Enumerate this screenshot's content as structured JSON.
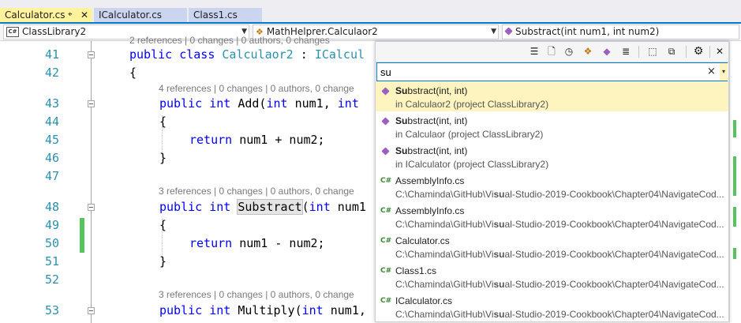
{
  "tabs": [
    {
      "label": "Calculator.cs",
      "active": true,
      "pin_icon": "pin-icon",
      "close_icon": "close-icon"
    },
    {
      "label": "ICalculator.cs",
      "active": false
    },
    {
      "label": "Class1.cs",
      "active": false
    }
  ],
  "navbar": {
    "project": "ClassLibrary2",
    "type": "MathHelprer.Calculaor2",
    "member": "Substract(int num1, int num2)"
  },
  "codelens": {
    "top_partial": "2 references | 0 changes | 0 authors, 0 changes",
    "add": "4 references | 0 changes | 0 authors, 0 change",
    "substract": "3 references | 0 changes | 0 authors, 0 change",
    "multiply": "3 references | 0 changes | 0 authors, 0 change"
  },
  "lines": {
    "n41": "41",
    "n42": "42",
    "n43": "43",
    "n44": "44",
    "n45": "45",
    "n46": "46",
    "n47": "47",
    "n48": "48",
    "n49": "49",
    "n50": "50",
    "n51": "51",
    "n52": "52",
    "n53": "53"
  },
  "code": {
    "l41_kw": "public class ",
    "l41_type": "Calculaor2",
    "l41_rest": " : ",
    "l41_iface": "ICalcul",
    "l42": "{",
    "l43_kw1": "public int ",
    "l43_name": "Add(",
    "l43_kw2": "int ",
    "l43_rest": "num1, ",
    "l43_kw3": "int",
    "l44": "{",
    "l45_kw": "return ",
    "l45_rest": "num1 + num2;",
    "l46": "}",
    "l48_kw1": "public int ",
    "l48_name": "Substract",
    "l48_paren": "(",
    "l48_kw2": "int ",
    "l48_rest": "num1",
    "l49": "{",
    "l50_kw": "return ",
    "l50_rest": "num1 - num2;",
    "l51": "}",
    "l53_kw1": "public int ",
    "l53_name": "Multiply(",
    "l53_kw2": "int ",
    "l53_rest": "num1,"
  },
  "popup": {
    "toolbar_icons": [
      "show-all-icon",
      "file-icon",
      "recent-icon",
      "type-icon",
      "member-icon",
      "text-icon",
      "current-document-icon",
      "preview-icon",
      "settings-icon",
      "close-icon"
    ],
    "search_value": "su",
    "clear_label": "×",
    "dropdown_label": "▾",
    "results": [
      {
        "icon": "method-icon",
        "bold": "Su",
        "title_rest": "bstract(int, int)",
        "sub_pre": "in Calculaor2 (project ClassLibrary2)",
        "sub_bold": "",
        "sub_post": "",
        "selected": true
      },
      {
        "icon": "method-icon",
        "bold": "Su",
        "title_rest": "bstract(int, int)",
        "sub_pre": "in Calculaor (project ClassLibrary2)",
        "sub_bold": "",
        "sub_post": "",
        "selected": false
      },
      {
        "icon": "method-icon",
        "bold": "Su",
        "title_rest": "bstract(int, int)",
        "sub_pre": "in ICalculator (project ClassLibrary2)",
        "sub_bold": "",
        "sub_post": "",
        "selected": false
      },
      {
        "icon": "csharp-file-icon",
        "bold": "",
        "title_rest": "AssemblyInfo.cs",
        "sub_pre": "C:\\Chaminda\\GitHub\\Vi",
        "sub_bold": "su",
        "sub_post": "al-Studio-2019-Cookbook\\Chapter04\\NavigateCod...",
        "selected": false
      },
      {
        "icon": "csharp-file-icon",
        "bold": "",
        "title_rest": "AssemblyInfo.cs",
        "sub_pre": "C:\\Chaminda\\GitHub\\Vi",
        "sub_bold": "su",
        "sub_post": "al-Studio-2019-Cookbook\\Chapter04\\NavigateCod...",
        "selected": false
      },
      {
        "icon": "csharp-file-icon",
        "bold": "",
        "title_rest": "Calculator.cs",
        "sub_pre": "C:\\Chaminda\\GitHub\\Vi",
        "sub_bold": "su",
        "sub_post": "al-Studio-2019-Cookbook\\Chapter04\\NavigateCod...",
        "selected": false
      },
      {
        "icon": "csharp-file-icon",
        "bold": "",
        "title_rest": "Class1.cs",
        "sub_pre": "C:\\Chaminda\\GitHub\\Vi",
        "sub_bold": "su",
        "sub_post": "al-Studio-2019-Cookbook\\Chapter04\\NavigateCod...",
        "selected": false
      },
      {
        "icon": "csharp-file-icon",
        "bold": "",
        "title_rest": "ICalculator.cs",
        "sub_pre": "C:\\Chaminda\\GitHub\\Vi",
        "sub_bold": "su",
        "sub_post": "al-Studio-2019-Cookbook\\Chapter04\\NavigateCod...",
        "selected": false
      }
    ]
  },
  "colors": {
    "accent": "#007acc",
    "active_tab": "#fff29d",
    "inactive_tab": "#ccd5f0",
    "selection": "#fdf4bf",
    "keyword": "#0000ff",
    "type": "#2b91af",
    "change_marker": "#57c35c"
  }
}
